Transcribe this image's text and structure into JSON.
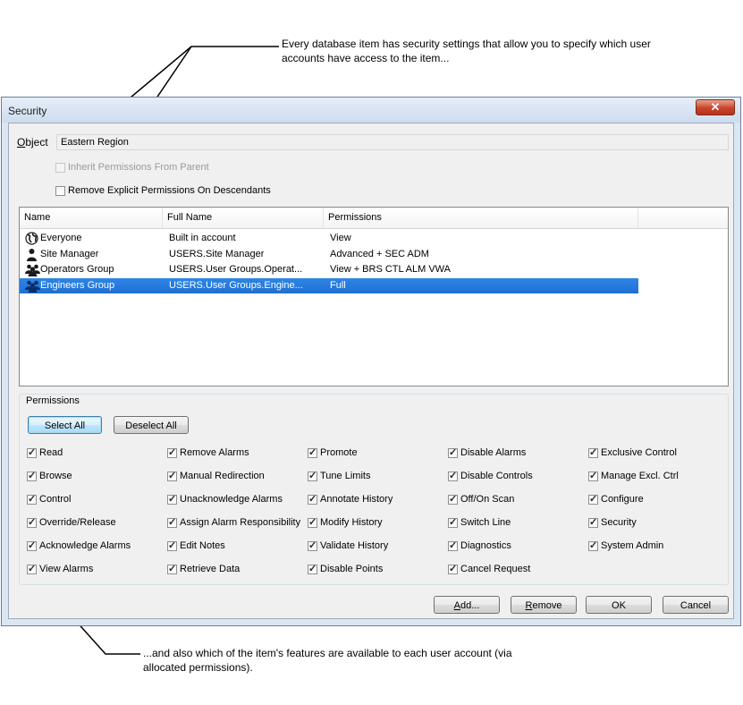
{
  "annotations": {
    "top": "Every database item has security settings that allow you to specify which user accounts have access to the item...",
    "bottom": "...and also which of the item's features are available to each user account (via allocated permissions)."
  },
  "window": {
    "title": "Security",
    "close_glyph": "✕"
  },
  "object": {
    "label": "Object",
    "value": "Eastern Region"
  },
  "options": {
    "inherit": {
      "label": "Inherit Permissions From Parent",
      "checked": false,
      "disabled": true
    },
    "remove_explicit": {
      "label": "Remove Explicit Permissions On Descendants",
      "checked": false,
      "disabled": false
    }
  },
  "accounts": {
    "columns": [
      "Name",
      "Full Name",
      "Permissions"
    ],
    "rows": [
      {
        "icon": "globe-icon",
        "name": "Everyone",
        "full_name": "Built in account",
        "permissions": "View",
        "selected": false
      },
      {
        "icon": "user-icon",
        "name": "Site Manager",
        "full_name": "USERS.Site Manager",
        "permissions": "Advanced + SEC ADM",
        "selected": false
      },
      {
        "icon": "user-group-icon",
        "name": "Operators Group",
        "full_name": "USERS.User Groups.Operat...",
        "permissions": "View + BRS CTL ALM VWA",
        "selected": false
      },
      {
        "icon": "user-group-icon",
        "name": "Engineers Group",
        "full_name": "USERS.User Groups.Engine...",
        "permissions": "Full",
        "selected": true
      }
    ]
  },
  "permissions": {
    "caption": "Permissions",
    "select_all": "Select All",
    "deselect_all": "Deselect All",
    "columns": [
      [
        "Read",
        "Browse",
        "Control",
        "Override/Release",
        "Acknowledge Alarms",
        "View Alarms"
      ],
      [
        "Remove Alarms",
        "Manual Redirection",
        "Unacknowledge Alarms",
        "Assign Alarm Responsibility",
        "Edit Notes",
        "Retrieve Data"
      ],
      [
        "Promote",
        "Tune Limits",
        "Annotate History",
        "Modify History",
        "Validate History",
        "Disable Points"
      ],
      [
        "Disable Alarms",
        "Disable Controls",
        "Off/On Scan",
        "Switch Line",
        "Diagnostics",
        "Cancel Request"
      ],
      [
        "Exclusive Control",
        "Manage Excl. Ctrl",
        "Configure",
        "Security",
        "System Admin"
      ]
    ]
  },
  "buttons": {
    "add": "Add...",
    "remove": "Remove",
    "ok": "OK",
    "cancel": "Cancel"
  }
}
